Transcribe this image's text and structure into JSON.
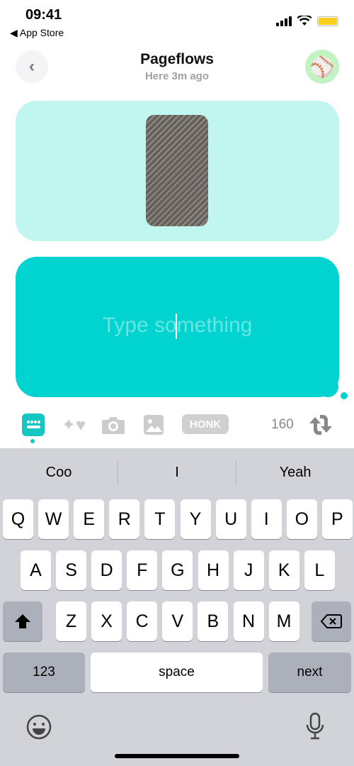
{
  "status": {
    "time": "09:41",
    "back_app": "◀ App Store"
  },
  "header": {
    "title": "Pageflows",
    "subtitle": "Here 3m ago",
    "back_icon": "chevron-left-icon",
    "avatar_emoji": "⚾"
  },
  "compose": {
    "placeholder": "Type something",
    "accent": "#00d3d0",
    "card_color": "#c1f5f0"
  },
  "toolbar": {
    "honk_label": "HONK",
    "char_count": "160"
  },
  "keyboard": {
    "predictions": [
      "Coo",
      "I",
      "Yeah"
    ],
    "row1": [
      "Q",
      "W",
      "E",
      "R",
      "T",
      "Y",
      "U",
      "I",
      "O",
      "P"
    ],
    "row2": [
      "A",
      "S",
      "D",
      "F",
      "G",
      "H",
      "J",
      "K",
      "L"
    ],
    "row3": [
      "Z",
      "X",
      "C",
      "V",
      "B",
      "N",
      "M"
    ],
    "numbers_label": "123",
    "space_label": "space",
    "next_label": "next"
  }
}
